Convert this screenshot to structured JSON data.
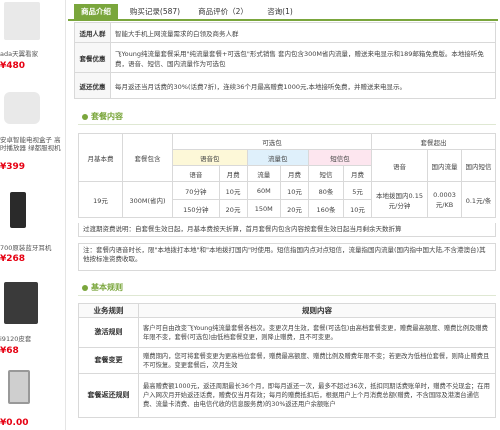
{
  "left_products": [
    {
      "name": "ada天翼看家",
      "price": "¥480"
    },
    {
      "name": "安卓智能电视盒子 高",
      "name2": "时播放器 绿都服视机",
      "price": "¥399"
    },
    {
      "name": "700原装蓝牙耳机",
      "price": "¥268"
    },
    {
      "name": "i9120皮套",
      "price": "¥68"
    },
    {
      "name": "",
      "price": "¥0.00"
    }
  ],
  "tabs": [
    "商品介绍",
    "购买记录(587)",
    "商品评价（2）",
    "咨询(1)"
  ],
  "info": [
    {
      "key": "适用人群",
      "value": "智能大手机上网流量需求的白领及商务人群"
    },
    {
      "key": "套餐优惠",
      "value": "飞Young纯流量套餐采用\"纯流量套餐+可选包\"形式销售 套内包含300M省内流量，赠送来电显示和189邮箱免费版。本地接听免费，语音、短信、国内流量作为可选包"
    },
    {
      "key": "返还优惠",
      "value": "每月返还当月话费的30%(话费7折)，连续36个月最高赠费1000元,本地接听免费，并赠送来电显示。"
    }
  ],
  "section_package": "套餐内容",
  "package": {
    "h_monthly": "月基本费",
    "h_in": "套餐包含",
    "h_optional": "可选包",
    "h_exceed": "套餐超出",
    "h_voice_pkg": "语音包",
    "h_data_pkg": "流量包",
    "h_sms_pkg": "短信包",
    "h_voice": "语音",
    "h_domestic_data": "国内流量",
    "h_domestic_sms": "国内短信",
    "sub_headers": [
      "语音",
      "月费",
      "流量",
      "月费",
      "短信",
      "月费"
    ],
    "monthly_fee": "19元",
    "included": "300M(省内)",
    "rows": [
      [
        "70分钟",
        "10元",
        "60M",
        "10元",
        "80条",
        "5元"
      ],
      [
        "150分钟",
        "20元",
        "150M",
        "20元",
        "160条",
        "10元"
      ]
    ],
    "exceed_voice": "本地拨国内0.15元/分钟",
    "exceed_data": "0.0003元/KB",
    "exceed_sms": "0.1元/条"
  },
  "note1": "过渡期资费说明：自套餐生效日起，月基本费按天折算，首月套餐内包含内容按套餐生效日起当月剩余天数折算",
  "note2": "注：套餐内语音时长，限\"本地拨打本地\"和\"本地拨打国内\"时使用。短信指国内点对点短信，流量指国内流量(国内指中国大陆,不含港澳台)其他按标准资费收取。",
  "section_rules": "基本规则",
  "rules": {
    "h_business": "业务规则",
    "h_content": "规则内容",
    "items": [
      {
        "key": "激活规则",
        "value": "客户可自由改变飞Young纯流量套餐各档次。变更次月生效，套餐(可选包)由高档套餐变更，赠费最高额度、赠费比例及赠费年限不变，套餐(可选包)由低档套餐变更，则降止赠费，且不可变更。"
      },
      {
        "key": "套餐变更",
        "value": "赠费期内，您可将套餐变更为更高档位套餐，赠费最高额度、赠费比例及赠费年限不变；若更改为低档位套餐，则降止赠费且不可恢复。变更套餐后，次月生效"
      },
      {
        "key": "套餐返还规则",
        "value": "最高赠费额1000元，返还周期最长36个月，即每月返还一次，最多不超过36次，抵扣同期话费账单时，赠费不兑现金；在用户入网次月开始返还话费，赠费仅当月有效；每月的赠费抵扣后，根据用户上个月消费总额(赠费，不含国际及港澳台通信费、流量卡消费、由电信代收的信息服务费)的30%返还用户余额账户"
      }
    ]
  }
}
